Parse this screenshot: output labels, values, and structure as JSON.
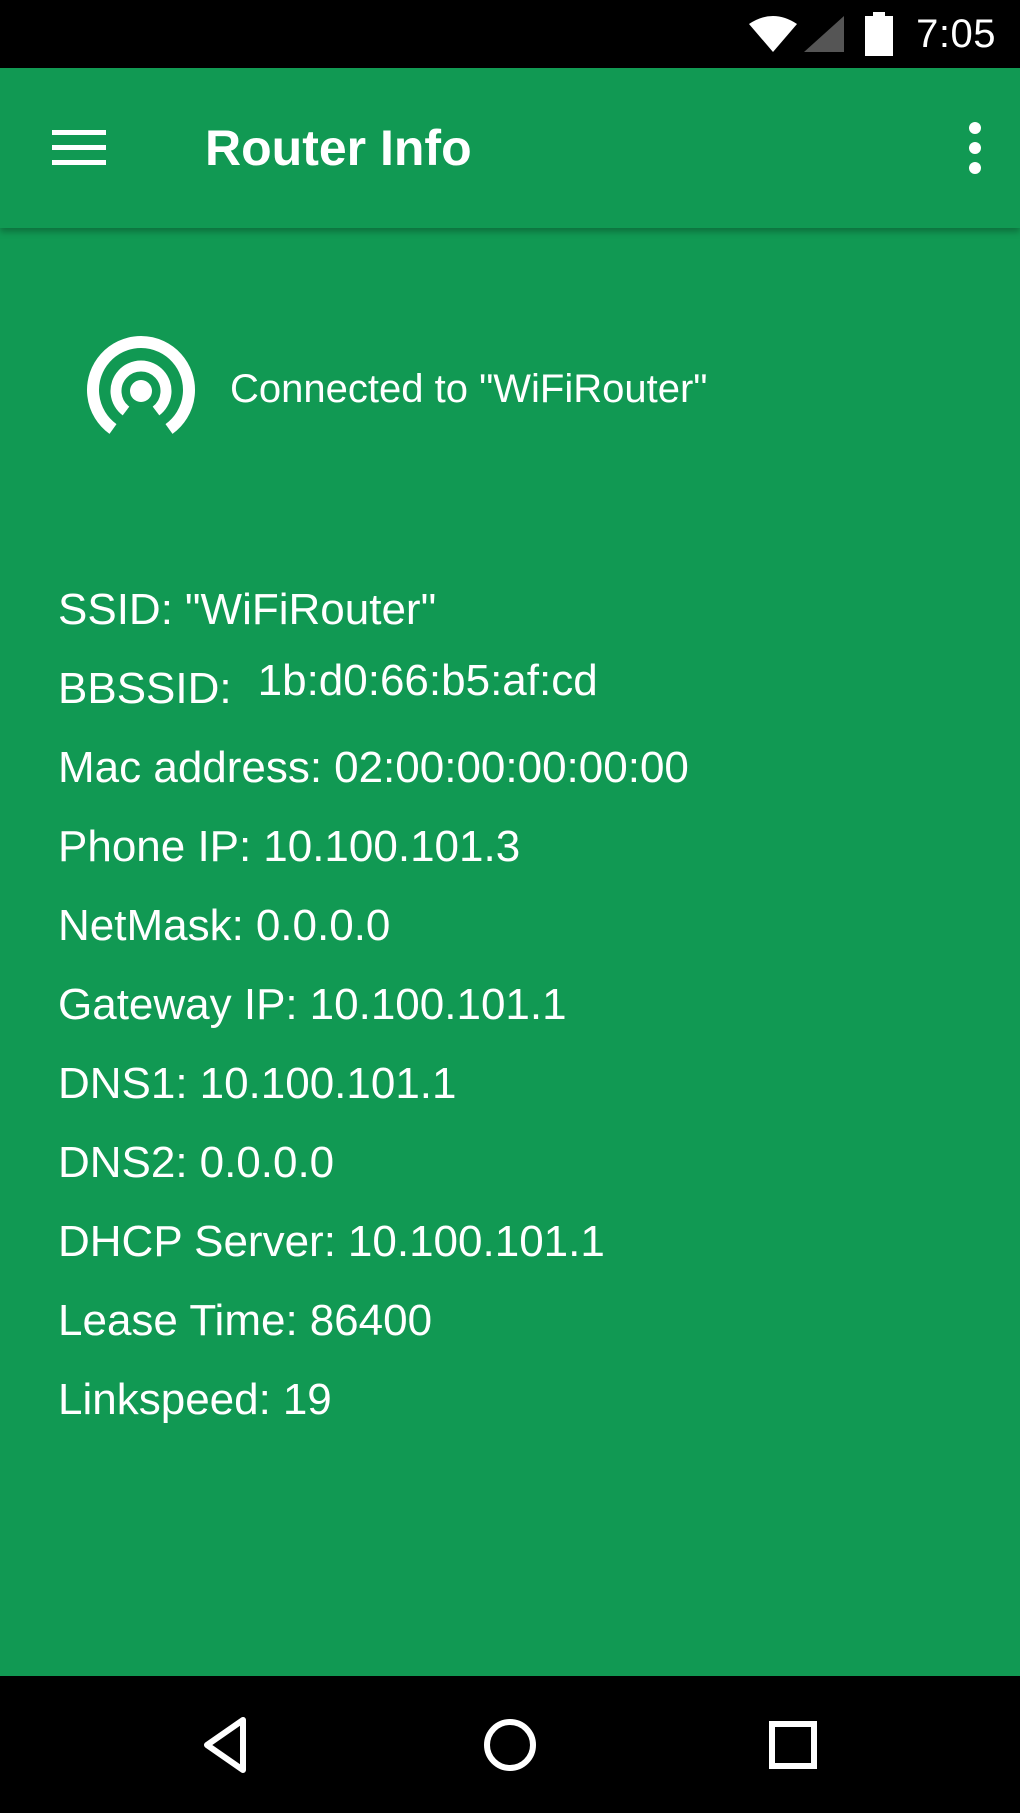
{
  "status_bar": {
    "time": "7:05",
    "icons": [
      "wifi-icon",
      "cell-signal-icon",
      "battery-icon"
    ]
  },
  "app_bar": {
    "title": "Router Info",
    "menu_icon": "hamburger-menu-icon",
    "overflow_icon": "more-vertical-icon"
  },
  "connection": {
    "icon": "wifi-hotspot-icon",
    "text": "Connected to \"WiFiRouter\""
  },
  "info": [
    {
      "label": "SSID:",
      "value": "\"WiFiRouter\""
    },
    {
      "label": "BBSSID:",
      "value": "1b:d0:66:b5:af:cd"
    },
    {
      "label": "Mac address:",
      "value": "02:00:00:00:00:00"
    },
    {
      "label": "Phone IP:",
      "value": "10.100.101.3"
    },
    {
      "label": "NetMask:",
      "value": "0.0.0.0"
    },
    {
      "label": "Gateway IP:",
      "value": "10.100.101.1"
    },
    {
      "label": "DNS1:",
      "value": "10.100.101.1"
    },
    {
      "label": "DNS2:",
      "value": "0.0.0.0"
    },
    {
      "label": "DHCP Server:",
      "value": "10.100.101.1"
    },
    {
      "label": "Lease Time:",
      "value": "86400"
    },
    {
      "label": "Linkspeed:",
      "value": "19"
    }
  ],
  "nav_bar": {
    "icons": [
      "back-icon",
      "home-icon",
      "recents-icon"
    ]
  },
  "colors": {
    "primary": "#119953",
    "bars": "#000000",
    "text": "#ffffff"
  }
}
